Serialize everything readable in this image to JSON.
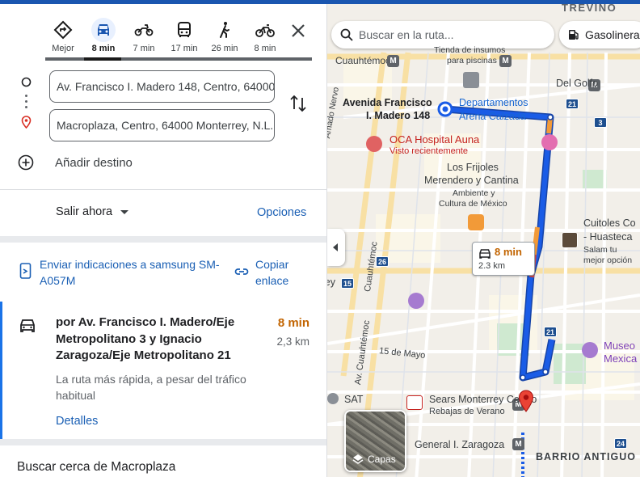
{
  "travel_modes": [
    {
      "name": "best",
      "label": "Mejor",
      "icon": "diamond-route-icon"
    },
    {
      "name": "car",
      "label": "8 min",
      "icon": "car-icon",
      "active": true
    },
    {
      "name": "motorcycle",
      "label": "7 min",
      "icon": "motorcycle-icon"
    },
    {
      "name": "transit",
      "label": "17 min",
      "icon": "bus-icon"
    },
    {
      "name": "walk",
      "label": "26 min",
      "icon": "walk-icon"
    },
    {
      "name": "bike",
      "label": "8 min",
      "icon": "bike-icon"
    }
  ],
  "route": {
    "origin_value": "Av. Francisco I. Madero 148, Centro, 64000",
    "destination_value": "Macroplaza, Centro, 64000 Monterrey, N.L.",
    "add_destination": "Añadir destino"
  },
  "depart": {
    "label": "Salir ahora",
    "options": "Opciones"
  },
  "send": {
    "label": "Enviar indicaciones a samsung SM-A057M",
    "copy": "Copiar enlace"
  },
  "route_option": {
    "via": "por Av. Francisco I. Madero/Eje Metropolitano 3 y Ignacio Zaragoza/Eje Metropolitano 21",
    "time": "8 min",
    "distance": "2,3 km",
    "note": "La ruta más rápida, a pesar del tráfico habitual",
    "details": "Detalles"
  },
  "nearby": "Buscar cerca de Macroplaza",
  "map": {
    "search_placeholder": "Buscar en la ruta...",
    "chip_gas": "Gasolineras",
    "bubble_time": "8 min",
    "bubble_distance": "2.3 km",
    "layers_label": "Capas",
    "labels": {
      "trevino": "TREVIÑO",
      "cuauhtemoc_top": "Cuauhtémoc",
      "tienda": "Tienda de insumos",
      "tienda2": "para piscinas",
      "del_golfo": "Del Golfo",
      "origin_name1": "Avenida Francisco",
      "origin_name2": "I. Madero 148",
      "departamentos": "Departamentos",
      "arena": "Arena Calzada",
      "oca": "OCA Hospital Auna",
      "oca_sub": "Visto recientemente",
      "frijoles1": "Los Frijoles",
      "frijoles2": "Merendero y Cantina",
      "ambiente1": "Ambiente y",
      "ambiente2": "Cultura de México",
      "cuitoles1": "Cuitoles Co",
      "cuitoles2": "- Huasteca",
      "cuitoles3": "Salam tu",
      "cuitoles4": "mejor opción",
      "cuauhtemoc_ave": "Av. Cuauhtémoc",
      "cuauhtemoc_side": "Cuauhtémoc",
      "amado": "Amado Nervo",
      "mayo": "15 de Mayo",
      "sat": "SAT",
      "sears1": "Sears Monterrey Centro",
      "sears2": "Rebajas de Verano",
      "zaragoza": "General I. Zaragoza",
      "barrio": "BARRIO ANTIGUO",
      "museo1": "Museo",
      "museo2": "Mexica",
      "ley": "ley"
    },
    "shields": [
      "21",
      "3",
      "26",
      "15",
      "21",
      "24"
    ],
    "metro": "M",
    "colors": {
      "route": "#1a5ce6",
      "traffic_orange": "#f29a38",
      "traffic_red": "#d14a4a",
      "accent": "#1a5fb4",
      "time_orange": "#c26401"
    }
  }
}
